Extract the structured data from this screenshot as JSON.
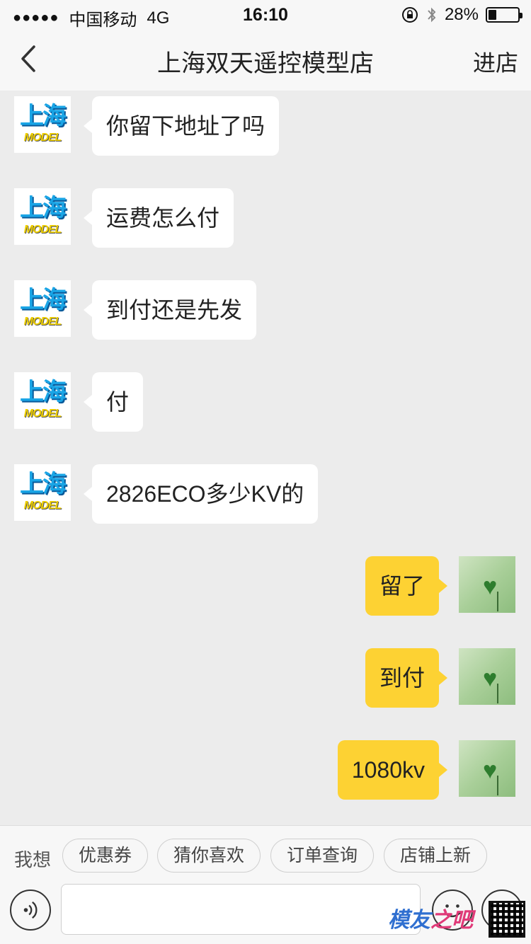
{
  "status_bar": {
    "carrier": "中国移动",
    "network": "4G",
    "time": "16:10",
    "battery": "28%",
    "battery_level": 0.28
  },
  "nav": {
    "title": "上海双天遥控模型店",
    "action_label": "进店"
  },
  "avatars": {
    "shop_line1": "上海",
    "shop_line2": "MODEL"
  },
  "messages": [
    {
      "side": "in",
      "text": "你留下地址了吗"
    },
    {
      "side": "in",
      "text": "运费怎么付"
    },
    {
      "side": "in",
      "text": "到付还是先发"
    },
    {
      "side": "in",
      "text": "付"
    },
    {
      "side": "in",
      "text": "2826ECO多少KV的"
    },
    {
      "side": "out",
      "text": "留了"
    },
    {
      "side": "out",
      "text": "到付"
    },
    {
      "side": "out",
      "text": "1080kv"
    }
  ],
  "quick_replies": {
    "label": "我想",
    "chips": [
      "优惠券",
      "猜你喜欢",
      "订单查询",
      "店铺上新"
    ]
  },
  "input": {
    "value": "",
    "placeholder": ""
  },
  "icons": {
    "back": "chevron-left-icon",
    "voice": "voice-icon",
    "emoji": "emoji-icon",
    "plus": "plus-icon",
    "lock": "rotation-lock-icon",
    "bluetooth": "bluetooth-icon",
    "battery": "battery-icon"
  },
  "watermark": {
    "text_blue": "模友",
    "text_pink": "之吧"
  },
  "colors": {
    "outgoing_bubble": "#fdd233",
    "incoming_bubble": "#ffffff",
    "chat_background": "#ececec",
    "bar_background": "#f7f7f7"
  }
}
